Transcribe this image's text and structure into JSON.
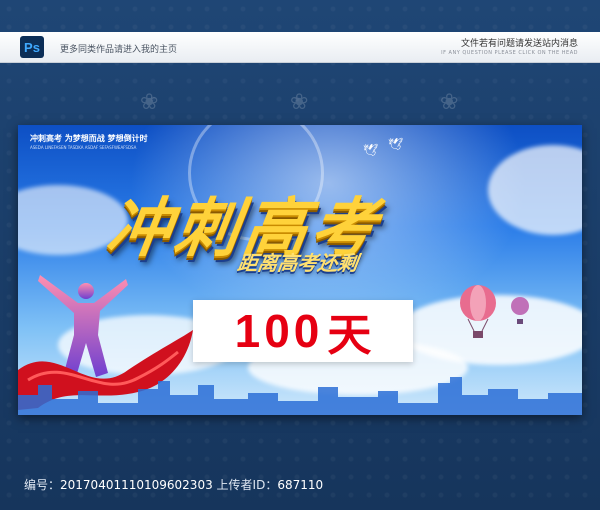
{
  "topbar": {
    "app_badge": "Ps",
    "left_text": "更多同类作品请进入我的主页",
    "right_text": "文件若有问题请发送站内消息",
    "right_subtext": "IF ANY QUESTION PLEASE CLICK ON THE HEAD"
  },
  "poster": {
    "slogan": "冲刺高考 为梦想而战 梦想倒计时",
    "slogan_sub": "ASEDA LINEFASEN TASDKA ASDAF SEFASFWEAFSDSA",
    "title": "冲刺高考",
    "subtitle": "距离高考还剩",
    "count_number": "100",
    "count_unit": "天"
  },
  "footer": {
    "id_label": "编号：",
    "id_value": "20170401110109602303",
    "uploader_label": "上传者ID：",
    "uploader_value": "687110"
  },
  "colors": {
    "accent_red": "#e60012",
    "title_gold": "#ffd23a",
    "frame_blue": "#1b3f6a"
  }
}
